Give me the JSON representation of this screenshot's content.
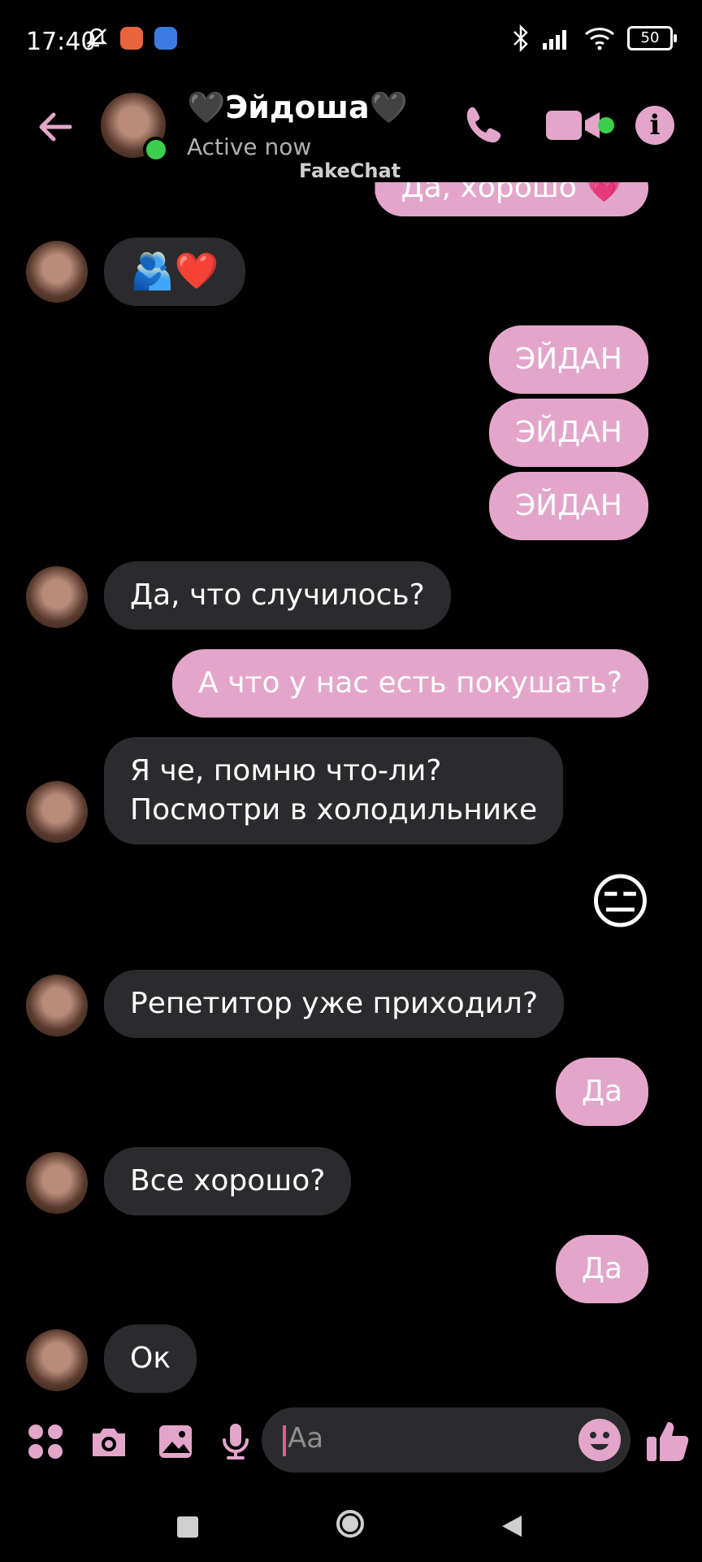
{
  "status": {
    "time": "17:40",
    "battery": "50"
  },
  "header": {
    "name": "🖤Эйдоша🖤",
    "status": "Active now",
    "watermark": "FakeChat"
  },
  "messages": {
    "m0": "Да, хорошо 💗",
    "m1": "🫂❤️",
    "m2": "ЭЙДАН",
    "m3": "ЭЙДАН",
    "m4": "ЭЙДАН",
    "m5": "Да, что случилось?",
    "m6": "А что у нас есть покушать?",
    "m7": "Я че, помню что-ли?\nПосмотри в холодильнике",
    "m8": "😑",
    "m9": "Репетитор уже приходил?",
    "m10": "Да",
    "m11": "Все хорошо?",
    "m12": "Да",
    "m13": "Ок"
  },
  "composer": {
    "placeholder": "Aa"
  },
  "colors": {
    "accent": "#e3a6ca",
    "incoming": "#2b2b2d",
    "online": "#3ccf4e"
  }
}
